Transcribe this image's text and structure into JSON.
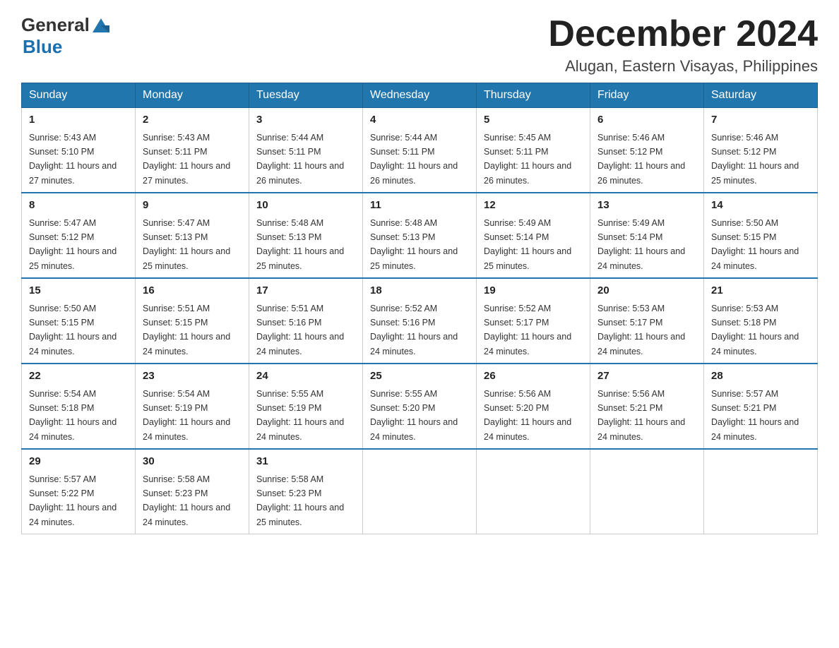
{
  "header": {
    "logo_general": "General",
    "logo_blue": "Blue",
    "month_title": "December 2024",
    "location": "Alugan, Eastern Visayas, Philippines"
  },
  "weekdays": [
    "Sunday",
    "Monday",
    "Tuesday",
    "Wednesday",
    "Thursday",
    "Friday",
    "Saturday"
  ],
  "weeks": [
    [
      {
        "day": "1",
        "sunrise": "5:43 AM",
        "sunset": "5:10 PM",
        "daylight": "11 hours and 27 minutes."
      },
      {
        "day": "2",
        "sunrise": "5:43 AM",
        "sunset": "5:11 PM",
        "daylight": "11 hours and 27 minutes."
      },
      {
        "day": "3",
        "sunrise": "5:44 AM",
        "sunset": "5:11 PM",
        "daylight": "11 hours and 26 minutes."
      },
      {
        "day": "4",
        "sunrise": "5:44 AM",
        "sunset": "5:11 PM",
        "daylight": "11 hours and 26 minutes."
      },
      {
        "day": "5",
        "sunrise": "5:45 AM",
        "sunset": "5:11 PM",
        "daylight": "11 hours and 26 minutes."
      },
      {
        "day": "6",
        "sunrise": "5:46 AM",
        "sunset": "5:12 PM",
        "daylight": "11 hours and 26 minutes."
      },
      {
        "day": "7",
        "sunrise": "5:46 AM",
        "sunset": "5:12 PM",
        "daylight": "11 hours and 25 minutes."
      }
    ],
    [
      {
        "day": "8",
        "sunrise": "5:47 AM",
        "sunset": "5:12 PM",
        "daylight": "11 hours and 25 minutes."
      },
      {
        "day": "9",
        "sunrise": "5:47 AM",
        "sunset": "5:13 PM",
        "daylight": "11 hours and 25 minutes."
      },
      {
        "day": "10",
        "sunrise": "5:48 AM",
        "sunset": "5:13 PM",
        "daylight": "11 hours and 25 minutes."
      },
      {
        "day": "11",
        "sunrise": "5:48 AM",
        "sunset": "5:13 PM",
        "daylight": "11 hours and 25 minutes."
      },
      {
        "day": "12",
        "sunrise": "5:49 AM",
        "sunset": "5:14 PM",
        "daylight": "11 hours and 25 minutes."
      },
      {
        "day": "13",
        "sunrise": "5:49 AM",
        "sunset": "5:14 PM",
        "daylight": "11 hours and 24 minutes."
      },
      {
        "day": "14",
        "sunrise": "5:50 AM",
        "sunset": "5:15 PM",
        "daylight": "11 hours and 24 minutes."
      }
    ],
    [
      {
        "day": "15",
        "sunrise": "5:50 AM",
        "sunset": "5:15 PM",
        "daylight": "11 hours and 24 minutes."
      },
      {
        "day": "16",
        "sunrise": "5:51 AM",
        "sunset": "5:15 PM",
        "daylight": "11 hours and 24 minutes."
      },
      {
        "day": "17",
        "sunrise": "5:51 AM",
        "sunset": "5:16 PM",
        "daylight": "11 hours and 24 minutes."
      },
      {
        "day": "18",
        "sunrise": "5:52 AM",
        "sunset": "5:16 PM",
        "daylight": "11 hours and 24 minutes."
      },
      {
        "day": "19",
        "sunrise": "5:52 AM",
        "sunset": "5:17 PM",
        "daylight": "11 hours and 24 minutes."
      },
      {
        "day": "20",
        "sunrise": "5:53 AM",
        "sunset": "5:17 PM",
        "daylight": "11 hours and 24 minutes."
      },
      {
        "day": "21",
        "sunrise": "5:53 AM",
        "sunset": "5:18 PM",
        "daylight": "11 hours and 24 minutes."
      }
    ],
    [
      {
        "day": "22",
        "sunrise": "5:54 AM",
        "sunset": "5:18 PM",
        "daylight": "11 hours and 24 minutes."
      },
      {
        "day": "23",
        "sunrise": "5:54 AM",
        "sunset": "5:19 PM",
        "daylight": "11 hours and 24 minutes."
      },
      {
        "day": "24",
        "sunrise": "5:55 AM",
        "sunset": "5:19 PM",
        "daylight": "11 hours and 24 minutes."
      },
      {
        "day": "25",
        "sunrise": "5:55 AM",
        "sunset": "5:20 PM",
        "daylight": "11 hours and 24 minutes."
      },
      {
        "day": "26",
        "sunrise": "5:56 AM",
        "sunset": "5:20 PM",
        "daylight": "11 hours and 24 minutes."
      },
      {
        "day": "27",
        "sunrise": "5:56 AM",
        "sunset": "5:21 PM",
        "daylight": "11 hours and 24 minutes."
      },
      {
        "day": "28",
        "sunrise": "5:57 AM",
        "sunset": "5:21 PM",
        "daylight": "11 hours and 24 minutes."
      }
    ],
    [
      {
        "day": "29",
        "sunrise": "5:57 AM",
        "sunset": "5:22 PM",
        "daylight": "11 hours and 24 minutes."
      },
      {
        "day": "30",
        "sunrise": "5:58 AM",
        "sunset": "5:23 PM",
        "daylight": "11 hours and 24 minutes."
      },
      {
        "day": "31",
        "sunrise": "5:58 AM",
        "sunset": "5:23 PM",
        "daylight": "11 hours and 25 minutes."
      },
      null,
      null,
      null,
      null
    ]
  ],
  "colors": {
    "header_bg": "#2176ae",
    "header_text": "#ffffff",
    "border": "#cccccc",
    "accent": "#2176ae"
  }
}
